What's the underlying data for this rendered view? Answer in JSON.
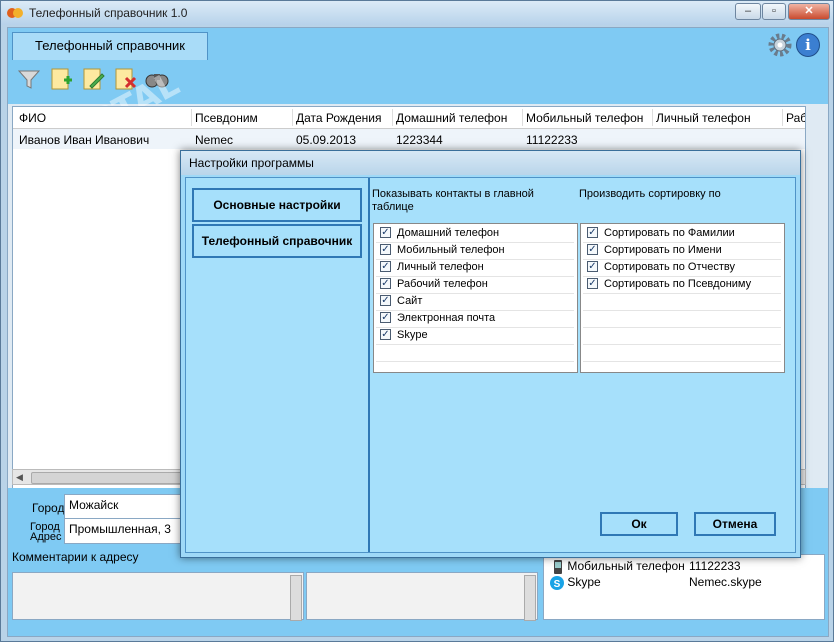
{
  "window": {
    "title": "Телефонный справочник 1.0"
  },
  "tabs": [
    {
      "label": "Телефонный справочник"
    }
  ],
  "grid": {
    "columns": [
      "ФИО",
      "Псевдоним",
      "Дата Рождения",
      "Домашний телефон",
      "Мобильный телефон",
      "Личный телефон",
      "Рабочи"
    ],
    "rows": [
      [
        "Иванов Иван Иванович",
        "Nemec",
        "05.09.2013",
        "1223344",
        "11122233",
        "",
        ""
      ]
    ]
  },
  "details": {
    "city_label": "Город",
    "city_value": "Можайск",
    "address_label": "Город Адрес",
    "address_value": "Промышленная, 3",
    "comment_label": "Комментарии к адресу",
    "contacts": [
      {
        "icon": "phone-icon",
        "label": "Мобильный телефон",
        "value": "11122233"
      },
      {
        "icon": "skype-icon",
        "label": "Skype",
        "value": "Nemec.skype"
      }
    ]
  },
  "dialog": {
    "title": "Настройки программы",
    "nav": [
      {
        "label": "Основные настройки"
      },
      {
        "label": "Телефонный справочник"
      }
    ],
    "show_header": "Показывать контакты в главной таблице",
    "sort_header": "Производить сортировку по",
    "show_items": [
      {
        "label": "Домашний телефон",
        "checked": true
      },
      {
        "label": "Мобильный телефон",
        "checked": true
      },
      {
        "label": "Личный телефон",
        "checked": true
      },
      {
        "label": "Рабочий телефон",
        "checked": true
      },
      {
        "label": "Сайт",
        "checked": true
      },
      {
        "label": "Электронная почта",
        "checked": true
      },
      {
        "label": "Skype",
        "checked": true
      }
    ],
    "sort_items": [
      {
        "label": "Сортировать по Фамилии",
        "checked": true
      },
      {
        "label": "Сортировать по Имени",
        "checked": true
      },
      {
        "label": "Сортировать по Отчеству",
        "checked": true
      },
      {
        "label": "Сортировать по Псевдониму",
        "checked": true
      }
    ],
    "ok_label": "Ок",
    "cancel_label": "Отмена"
  },
  "colors": {
    "panel": "#7fcaf3",
    "dialog": "#a6e0fb",
    "accent": "#2f78b5"
  }
}
